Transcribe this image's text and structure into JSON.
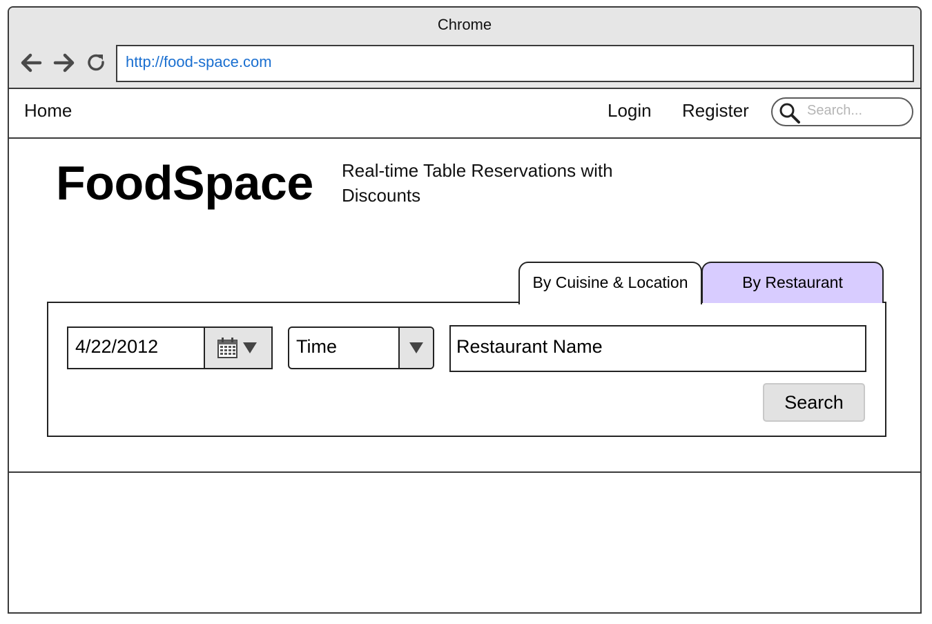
{
  "browser": {
    "title": "Chrome",
    "url": "http://food-space.com",
    "back_icon": "arrow-left-icon",
    "forward_icon": "arrow-right-icon",
    "reload_icon": "reload-icon"
  },
  "navbar": {
    "home": "Home",
    "login": "Login",
    "register": "Register",
    "search_placeholder": "Search..."
  },
  "header": {
    "brand": "FoodSpace",
    "tagline": "Real-time Table Reservations with Discounts"
  },
  "tabs": [
    {
      "label": "By Cuisine & Location",
      "active": true
    },
    {
      "label": "By Restaurant",
      "active": false,
      "color": "#d8ccff"
    }
  ],
  "form": {
    "date": "4/22/2012",
    "time": "Time",
    "restaurant_name": "Restaurant Name",
    "search_button": "Search"
  }
}
